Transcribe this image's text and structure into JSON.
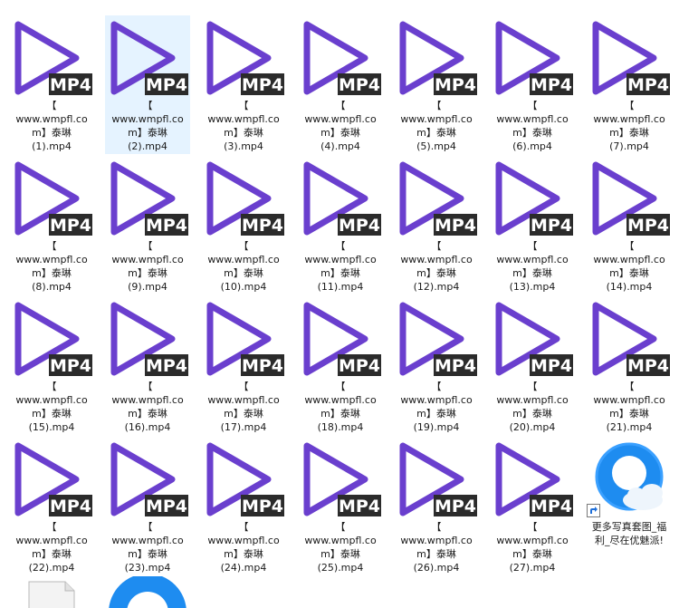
{
  "colors": {
    "play_purple": "#6a3fce",
    "badge_dark": "#2b2b2b",
    "badge_text": "#ffffff",
    "selection": "#e5f3ff",
    "browser_blue": "#1e8cf0"
  },
  "badge_text": "MP4",
  "files": [
    {
      "l1": "【",
      "l2": "www.wmpfl.co",
      "l3": "m】泰琳",
      "l4": "(1).mp4"
    },
    {
      "l1": "【",
      "l2": "www.wmpfl.co",
      "l3": "m】泰琳",
      "l4": "(2).mp4",
      "selected": true
    },
    {
      "l1": "【",
      "l2": "www.wmpfl.co",
      "l3": "m】泰琳",
      "l4": "(3).mp4"
    },
    {
      "l1": "【",
      "l2": "www.wmpfl.co",
      "l3": "m】泰琳",
      "l4": "(4).mp4"
    },
    {
      "l1": "【",
      "l2": "www.wmpfl.co",
      "l3": "m】泰琳",
      "l4": "(5).mp4"
    },
    {
      "l1": "【",
      "l2": "www.wmpfl.co",
      "l3": "m】泰琳",
      "l4": "(6).mp4"
    },
    {
      "l1": "【",
      "l2": "www.wmpfl.co",
      "l3": "m】泰琳",
      "l4": "(7).mp4"
    },
    {
      "l1": "【",
      "l2": "www.wmpfl.co",
      "l3": "m】泰琳",
      "l4": "(8).mp4"
    },
    {
      "l1": "【",
      "l2": "www.wmpfl.co",
      "l3": "m】泰琳",
      "l4": "(9).mp4"
    },
    {
      "l1": "【",
      "l2": "www.wmpfl.co",
      "l3": "m】泰琳",
      "l4": "(10).mp4"
    },
    {
      "l1": "【",
      "l2": "www.wmpfl.co",
      "l3": "m】泰琳",
      "l4": "(11).mp4"
    },
    {
      "l1": "【",
      "l2": "www.wmpfl.co",
      "l3": "m】泰琳",
      "l4": "(12).mp4"
    },
    {
      "l1": "【",
      "l2": "www.wmpfl.co",
      "l3": "m】泰琳",
      "l4": "(13).mp4"
    },
    {
      "l1": "【",
      "l2": "www.wmpfl.co",
      "l3": "m】泰琳",
      "l4": "(14).mp4"
    },
    {
      "l1": "【",
      "l2": "www.wmpfl.co",
      "l3": "m】泰琳",
      "l4": "(15).mp4"
    },
    {
      "l1": "【",
      "l2": "www.wmpfl.co",
      "l3": "m】泰琳",
      "l4": "(16).mp4"
    },
    {
      "l1": "【",
      "l2": "www.wmpfl.co",
      "l3": "m】泰琳",
      "l4": "(17).mp4"
    },
    {
      "l1": "【",
      "l2": "www.wmpfl.co",
      "l3": "m】泰琳",
      "l4": "(18).mp4"
    },
    {
      "l1": "【",
      "l2": "www.wmpfl.co",
      "l3": "m】泰琳",
      "l4": "(19).mp4"
    },
    {
      "l1": "【",
      "l2": "www.wmpfl.co",
      "l3": "m】泰琳",
      "l4": "(20).mp4"
    },
    {
      "l1": "【",
      "l2": "www.wmpfl.co",
      "l3": "m】泰琳",
      "l4": "(21).mp4"
    },
    {
      "l1": "【",
      "l2": "www.wmpfl.co",
      "l3": "m】泰琳",
      "l4": "(22).mp4"
    },
    {
      "l1": "【",
      "l2": "www.wmpfl.co",
      "l3": "m】泰琳",
      "l4": "(23).mp4"
    },
    {
      "l1": "【",
      "l2": "www.wmpfl.co",
      "l3": "m】泰琳",
      "l4": "(24).mp4"
    },
    {
      "l1": "【",
      "l2": "www.wmpfl.co",
      "l3": "m】泰琳",
      "l4": "(25).mp4"
    },
    {
      "l1": "【",
      "l2": "www.wmpfl.co",
      "l3": "m】泰琳",
      "l4": "(26).mp4"
    },
    {
      "l1": "【",
      "l2": "www.wmpfl.co",
      "l3": "m】泰琳",
      "l4": "(27).mp4"
    }
  ],
  "shortcut": {
    "line1": "更多写真套图_福",
    "line2": "利_尽在优魅派!",
    "icon": "browser-shortcut-icon"
  },
  "partial_items": [
    {
      "icon": "text-document-icon"
    },
    {
      "icon": "browser-icon"
    }
  ]
}
